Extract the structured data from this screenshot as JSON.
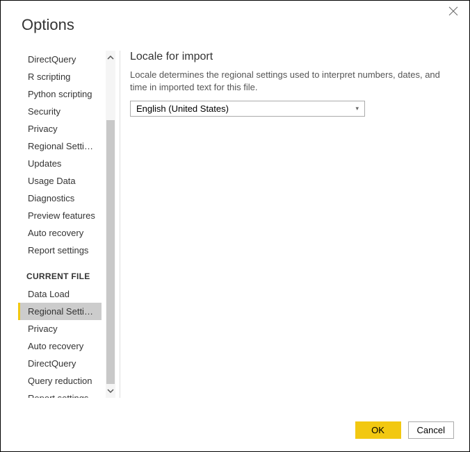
{
  "dialog": {
    "title": "Options"
  },
  "sidebar": {
    "global_items": [
      {
        "label": "DirectQuery"
      },
      {
        "label": "R scripting"
      },
      {
        "label": "Python scripting"
      },
      {
        "label": "Security"
      },
      {
        "label": "Privacy"
      },
      {
        "label": "Regional Settings"
      },
      {
        "label": "Updates"
      },
      {
        "label": "Usage Data"
      },
      {
        "label": "Diagnostics"
      },
      {
        "label": "Preview features"
      },
      {
        "label": "Auto recovery"
      },
      {
        "label": "Report settings"
      }
    ],
    "section_header": "CURRENT FILE",
    "current_file_items": [
      {
        "label": "Data Load"
      },
      {
        "label": "Regional Settings",
        "selected": true
      },
      {
        "label": "Privacy"
      },
      {
        "label": "Auto recovery"
      },
      {
        "label": "DirectQuery"
      },
      {
        "label": "Query reduction"
      },
      {
        "label": "Report settings"
      }
    ]
  },
  "main": {
    "heading": "Locale for import",
    "description": "Locale determines the regional settings used to interpret numbers, dates, and time in imported text for this file.",
    "dropdown_value": "English (United States)"
  },
  "footer": {
    "ok": "OK",
    "cancel": "Cancel"
  }
}
